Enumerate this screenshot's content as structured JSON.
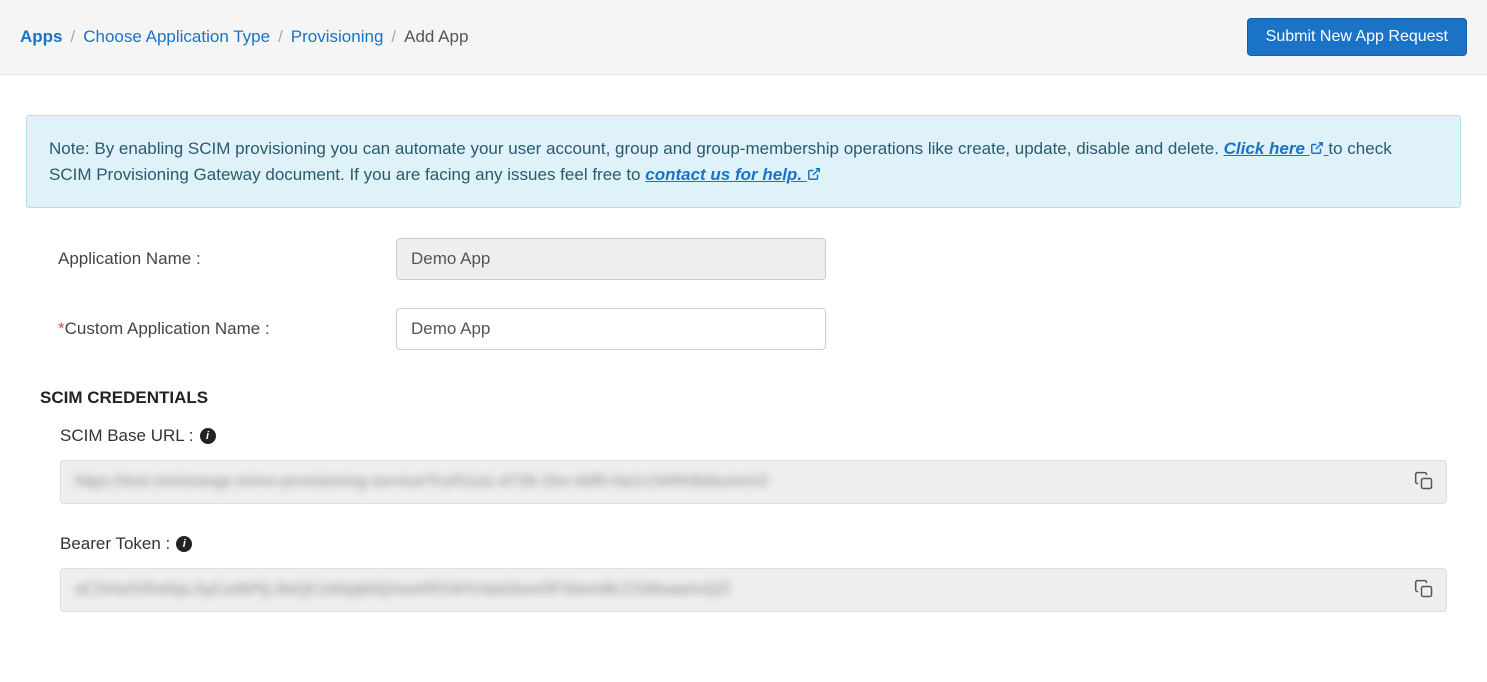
{
  "breadcrumb": {
    "items": [
      {
        "label": "Apps",
        "link": true
      },
      {
        "label": "Choose Application Type",
        "link": true
      },
      {
        "label": "Provisioning",
        "link": true
      },
      {
        "label": "Add App",
        "link": false
      }
    ]
  },
  "header": {
    "submit_button": "Submit New App Request"
  },
  "notice": {
    "prefix": "Note: By enabling SCIM provisioning you can automate your user account, group and group-membership operations like create, update, disable and delete. ",
    "click_here": "Click here",
    "middle": " to check SCIM Provisioning Gateway document. If you are facing any issues feel free to ",
    "contact": "contact us for help."
  },
  "form": {
    "app_name_label": "Application Name :",
    "app_name_value": "Demo App",
    "custom_name_label": "Custom Application Name :",
    "custom_name_value": "Demo App"
  },
  "credentials": {
    "section_title": "SCIM CREDENTIALS",
    "base_url_label": "SCIM Base URL :",
    "base_url_value": "https://test.miniorange.in/mo-provisioning-service/Tcs/f11a1-d728-1fec-b0f0-0a1c194f43b9scim/v2",
    "bearer_label": "Bearer Token :",
    "bearer_value": "aCSXar53hsNyLAyCa4bPjL3teQCzdAjqb0QmwARS3HVstaGbsnOFSbemBLCGt8xaaAxQZl"
  }
}
